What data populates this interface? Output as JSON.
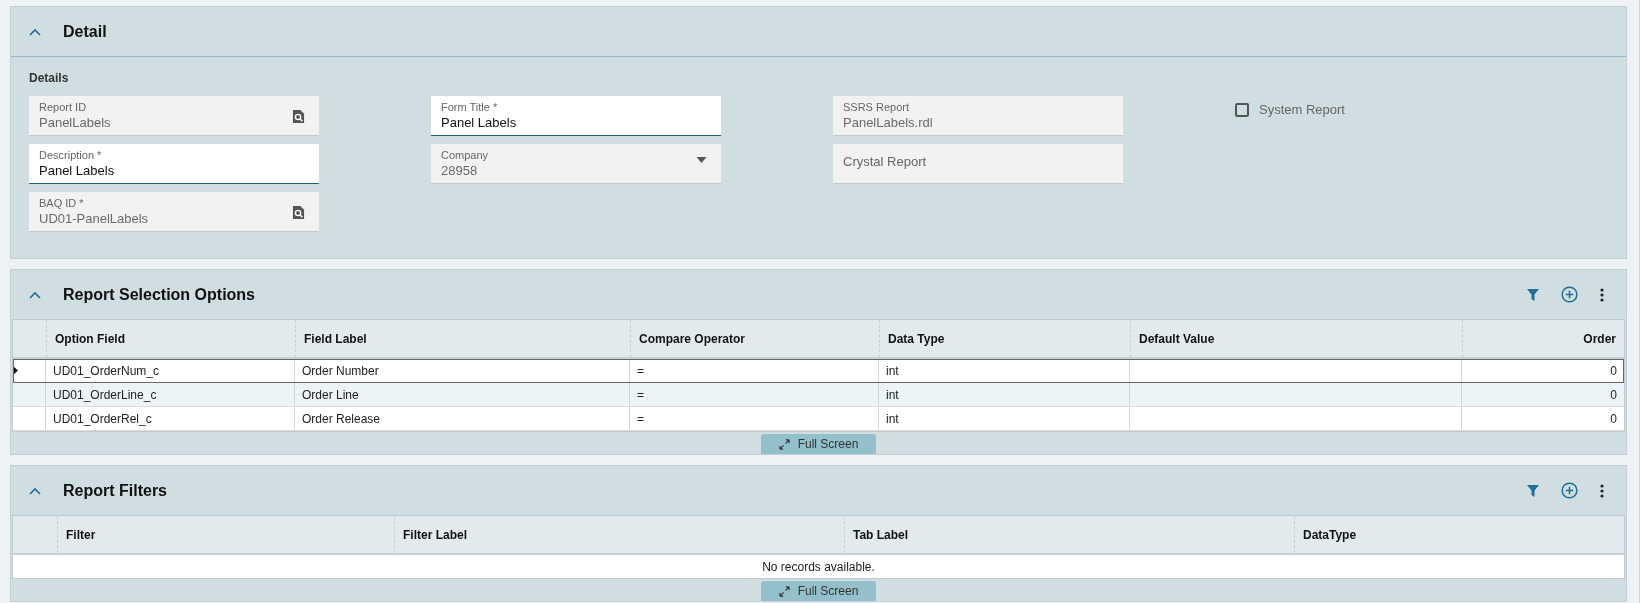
{
  "detail": {
    "title": "Detail",
    "expanded": true,
    "section_label": "Details",
    "field_columns": [
      [
        {
          "label": "Report ID",
          "value": "PanelLabels",
          "kind": "lookup"
        },
        {
          "label": "Description *",
          "value": "Panel Labels",
          "kind": "text"
        },
        {
          "label": "BAQ ID *",
          "value": "UD01-PanelLabels",
          "kind": "lookup"
        }
      ],
      [
        {
          "label": "Form Title *",
          "value": "Panel Labels",
          "kind": "text"
        },
        {
          "label": "Company",
          "value": "28958",
          "kind": "dropdown"
        }
      ],
      [
        {
          "label": "SSRS Report",
          "value": "PanelLabels.rdl",
          "kind": "readonly"
        },
        {
          "label": "Crystal Report",
          "kind": "readonly"
        }
      ]
    ],
    "checkbox": {
      "label": "System Report",
      "checked": false
    }
  },
  "selection_options": {
    "title": "Report Selection Options",
    "expanded": true,
    "columns": [
      "Option Field",
      "Field Label",
      "Compare Operator",
      "Data Type",
      "Default Value",
      "Order"
    ],
    "rows": [
      {
        "selected": true,
        "cells": [
          "UD01_OrderNum_c",
          "Order Number",
          "=",
          "int",
          "",
          "0"
        ]
      },
      {
        "selected": false,
        "cells": [
          "UD01_OrderLine_c",
          "Order Line",
          "=",
          "int",
          "",
          "0"
        ]
      },
      {
        "selected": false,
        "cells": [
          "UD01_OrderRel_c",
          "Order Release",
          "=",
          "int",
          "",
          "0"
        ]
      }
    ],
    "full_screen_label": "Full Screen"
  },
  "filters": {
    "title": "Report Filters",
    "expanded": true,
    "columns": [
      "Filter",
      "Filter Label",
      "Tab Label",
      "DataType"
    ],
    "empty_text": "No records available.",
    "full_screen_label": "Full Screen"
  }
}
